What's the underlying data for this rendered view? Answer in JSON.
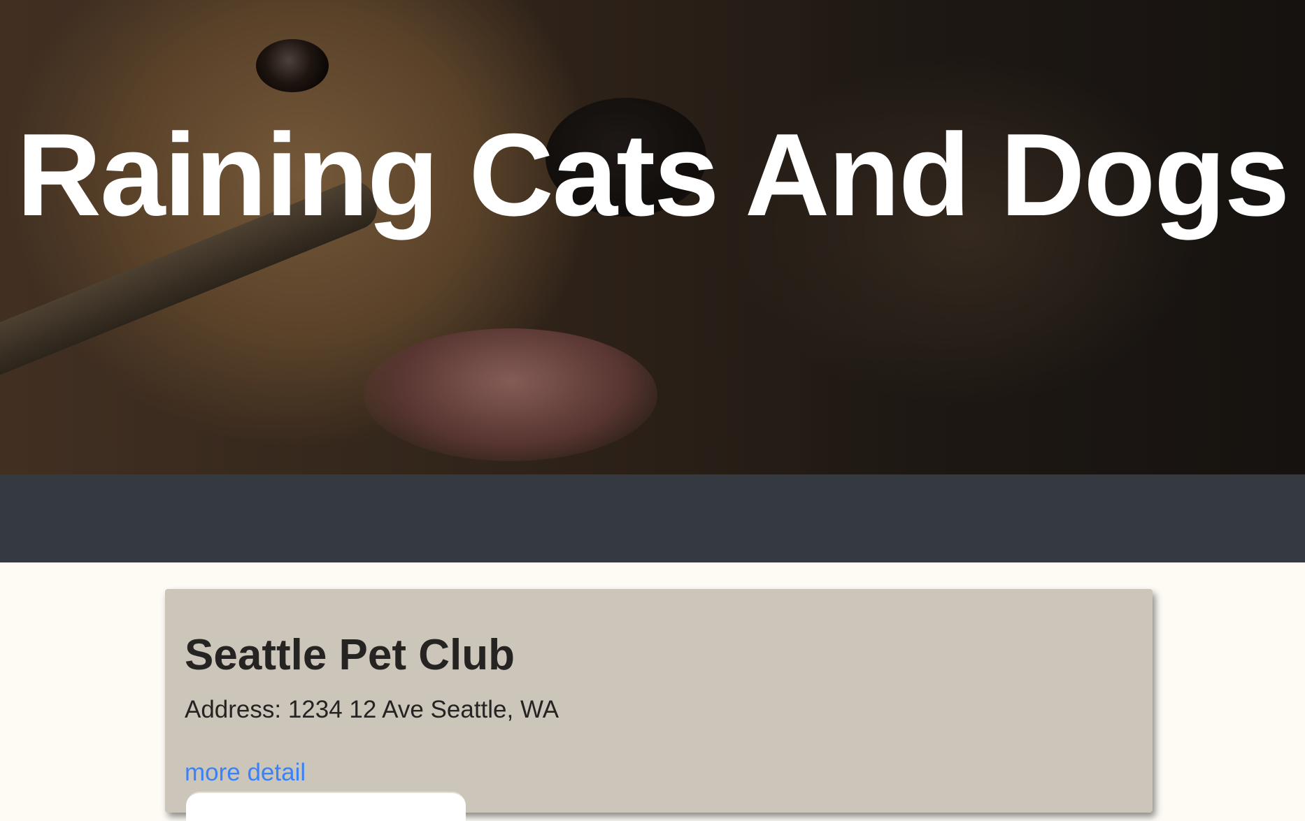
{
  "hero": {
    "title": "Raining Cats And Dogs"
  },
  "club": {
    "name": "Seattle Pet Club",
    "address": "Address: 1234 12 Ave Seattle, WA",
    "link_label": "more detail"
  }
}
